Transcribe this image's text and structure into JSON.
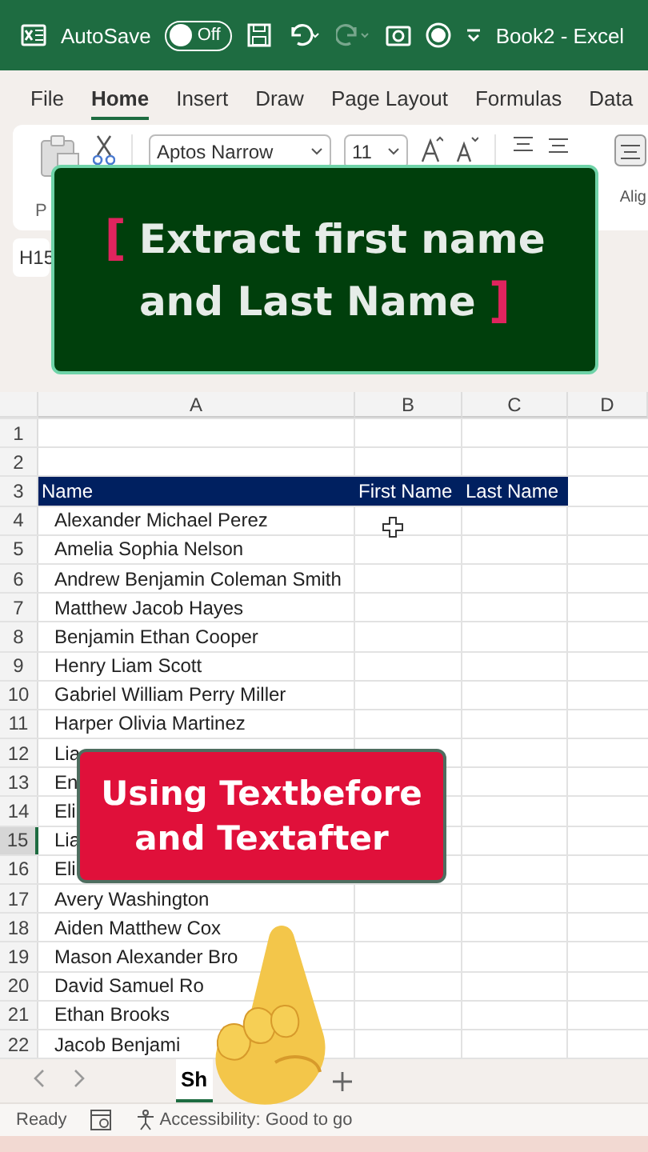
{
  "title_bar": {
    "autosave_label": "AutoSave",
    "autosave": {
      "on": false,
      "label": "Off"
    },
    "redo_disabled": true,
    "document_title": "Book2 - Excel"
  },
  "tabs": [
    {
      "label": "File",
      "selected": false
    },
    {
      "label": "Home",
      "selected": true
    },
    {
      "label": "Insert",
      "selected": false
    },
    {
      "label": "Draw",
      "selected": false
    },
    {
      "label": "Page Layout",
      "selected": false
    },
    {
      "label": "Formulas",
      "selected": false
    },
    {
      "label": "Data",
      "selected": false
    }
  ],
  "ribbon": {
    "paste_label": "P",
    "font_name": "Aptos Narrow",
    "font_size": "11",
    "group_label": "Alig"
  },
  "name_box": "H15",
  "columns": [
    "A",
    "B",
    "C",
    "D"
  ],
  "rows": [
    {
      "number": "1",
      "kind": "data",
      "selected": false
    },
    {
      "number": "2",
      "kind": "data",
      "selected": false
    },
    {
      "number": "3",
      "kind": "header",
      "selected": false,
      "cells": [
        "Name",
        "First Name",
        "Last Name"
      ]
    },
    {
      "number": "4",
      "kind": "data",
      "selected": false,
      "cells": [
        "Alexander Michael Perez"
      ]
    },
    {
      "number": "5",
      "kind": "data",
      "selected": false,
      "cells": [
        "Amelia Sophia Nelson"
      ]
    },
    {
      "number": "6",
      "kind": "data",
      "selected": false,
      "cells": [
        "Andrew Benjamin Coleman Smith"
      ]
    },
    {
      "number": "7",
      "kind": "data",
      "selected": false,
      "cells": [
        "Matthew Jacob Hayes"
      ]
    },
    {
      "number": "8",
      "kind": "data",
      "selected": false,
      "cells": [
        "Benjamin Ethan Cooper"
      ]
    },
    {
      "number": "9",
      "kind": "data",
      "selected": false,
      "cells": [
        "Henry Liam Scott"
      ]
    },
    {
      "number": "10",
      "kind": "data",
      "selected": false,
      "cells": [
        "Gabriel William Perry Miller"
      ]
    },
    {
      "number": "11",
      "kind": "data",
      "selected": false,
      "cells": [
        "Harper Olivia Martinez"
      ]
    },
    {
      "number": "12",
      "kind": "data",
      "selected": false,
      "cells": [
        "Lia"
      ]
    },
    {
      "number": "13",
      "kind": "data",
      "selected": false,
      "cells": [
        "En"
      ]
    },
    {
      "number": "14",
      "kind": "data",
      "selected": false,
      "cells": [
        "Eli"
      ]
    },
    {
      "number": "15",
      "kind": "data",
      "selected": true,
      "cells": [
        "Lia"
      ]
    },
    {
      "number": "16",
      "kind": "data",
      "selected": false,
      "cells": [
        "Eli"
      ]
    },
    {
      "number": "17",
      "kind": "data",
      "selected": false,
      "cells": [
        "Avery Washington"
      ]
    },
    {
      "number": "18",
      "kind": "data",
      "selected": false,
      "cells": [
        "Aiden Matthew Cox"
      ]
    },
    {
      "number": "19",
      "kind": "data",
      "selected": false,
      "cells": [
        "Mason Alexander Bro"
      ]
    },
    {
      "number": "20",
      "kind": "data",
      "selected": false,
      "cells": [
        "David Samuel Ro"
      ]
    },
    {
      "number": "21",
      "kind": "data",
      "selected": false,
      "cells": [
        "Ethan Brooks"
      ]
    },
    {
      "number": "22",
      "kind": "data",
      "selected": false,
      "cells": [
        "Jacob Benjami"
      ]
    }
  ],
  "sheet_tabs": [
    {
      "label": "Sh",
      "selected": true
    }
  ],
  "status_bar": {
    "state": "Ready",
    "accessibility": "Accessibility: Good to go"
  },
  "title_banner": {
    "open": "[",
    "lines": [
      "Extract first name",
      "and Last Name"
    ],
    "close": "]"
  },
  "subtitle_banner": {
    "lines": [
      "Using Textbefore",
      "and Textafter"
    ]
  }
}
